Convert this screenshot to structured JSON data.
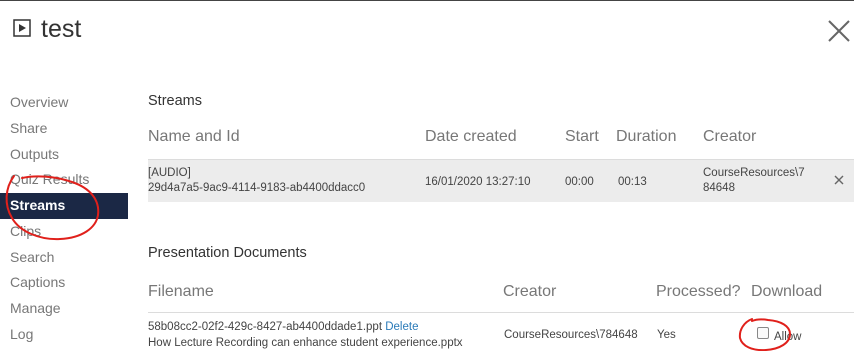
{
  "window": {
    "title": "test",
    "close_icon": "close-icon",
    "media_icon": "play-icon"
  },
  "sidebar": {
    "items": [
      {
        "label": "Overview",
        "active": false
      },
      {
        "label": "Share",
        "active": false
      },
      {
        "label": "Outputs",
        "active": false
      },
      {
        "label": "Quiz Results",
        "active": false
      },
      {
        "label": "Streams",
        "active": true
      },
      {
        "label": "Clips",
        "active": false
      },
      {
        "label": "Search",
        "active": false
      },
      {
        "label": "Captions",
        "active": false
      },
      {
        "label": "Manage",
        "active": false
      },
      {
        "label": "Log",
        "active": false
      }
    ]
  },
  "streams": {
    "heading": "Streams",
    "columns": {
      "name": "Name and Id",
      "date": "Date created",
      "start": "Start",
      "duration": "Duration",
      "creator": "Creator"
    },
    "rows": [
      {
        "name_line1": "[AUDIO]",
        "name_line2": "29d4a7a5-9ac9-4114-9183-ab4400ddacc0",
        "date": "16/01/2020 13:27:10",
        "start": "00:00",
        "duration": "00:13",
        "creator_line1": "CourseResources\\7",
        "creator_line2": "84648"
      }
    ]
  },
  "documents": {
    "heading": "Presentation Documents",
    "columns": {
      "filename": "Filename",
      "creator": "Creator",
      "processed": "Processed?",
      "download": "Download"
    },
    "rows": [
      {
        "file_id": "58b08cc2-02f2-429c-8427-ab4400ddade1.ppt",
        "delete_label": "Delete",
        "file_name": "How Lecture Recording can enhance student experience.pptx",
        "creator": "CourseResources\\784648",
        "processed": "Yes",
        "allow_label": "Allow",
        "allow_checked": false
      }
    ]
  },
  "colors": {
    "active_nav_bg": "#1b2845",
    "row_highlight": "#ececec",
    "link": "#2a7ab8",
    "annotation": "#e0201b"
  }
}
